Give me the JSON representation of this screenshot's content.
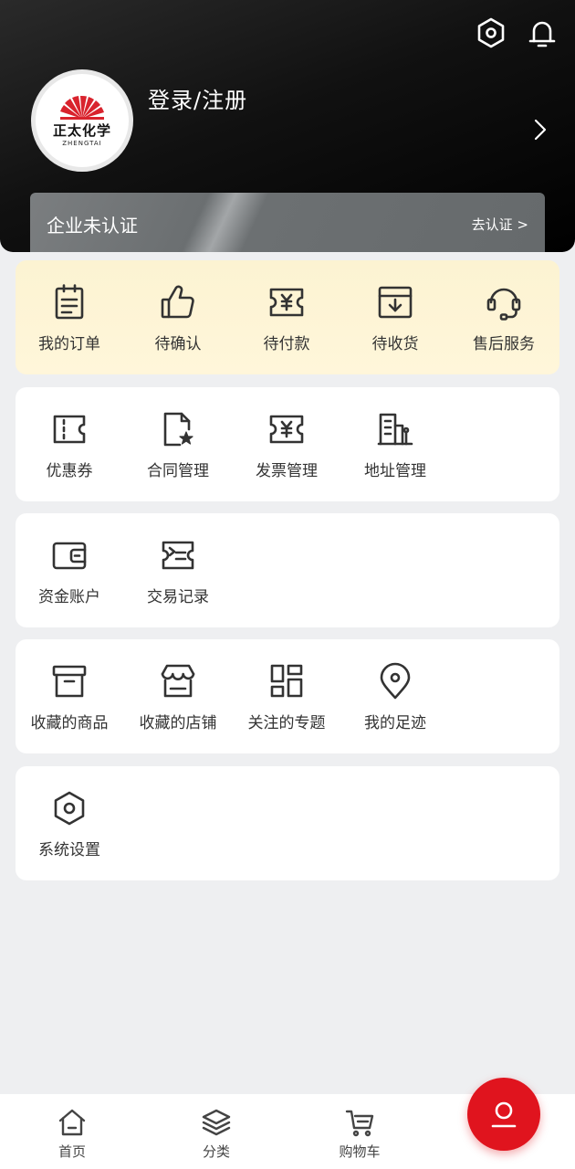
{
  "header": {
    "login_label": "登录/注册",
    "logo": {
      "cn": "正太化学",
      "en": "ZHENGTAI"
    },
    "cert": {
      "status": "企业未认证",
      "action": "去认证 >"
    }
  },
  "orders": [
    {
      "label": "我的订单",
      "icon": "clipboard-icon"
    },
    {
      "label": "待确认",
      "icon": "thumbs-up-icon"
    },
    {
      "label": "待付款",
      "icon": "ticket-icon"
    },
    {
      "label": "待收货",
      "icon": "inbox-icon"
    },
    {
      "label": "售后服务",
      "icon": "headset-icon"
    }
  ],
  "tools": [
    {
      "label": "优惠券",
      "icon": "coupon-icon"
    },
    {
      "label": "合同管理",
      "icon": "contract-icon"
    },
    {
      "label": "发票管理",
      "icon": "invoice-icon"
    },
    {
      "label": "地址管理",
      "icon": "building-icon"
    }
  ],
  "finance": [
    {
      "label": "资金账户",
      "icon": "wallet-icon"
    },
    {
      "label": "交易记录",
      "icon": "receipt-icon"
    }
  ],
  "favorites": [
    {
      "label": "收藏的商品",
      "icon": "archive-box-icon"
    },
    {
      "label": "收藏的店铺",
      "icon": "store-icon"
    },
    {
      "label": "关注的专题",
      "icon": "grid-icon"
    },
    {
      "label": "我的足迹",
      "icon": "location-pin-icon"
    }
  ],
  "system": [
    {
      "label": "系统设置",
      "icon": "settings-hex-icon"
    }
  ],
  "tabbar": [
    {
      "label": "首页",
      "icon": "home-icon"
    },
    {
      "label": "分类",
      "icon": "layers-icon"
    },
    {
      "label": "购物车",
      "icon": "cart-icon"
    }
  ],
  "colors": {
    "accent": "#e0141e",
    "orders_bg": "#fcf3d2",
    "page_bg": "#eeeff1"
  }
}
